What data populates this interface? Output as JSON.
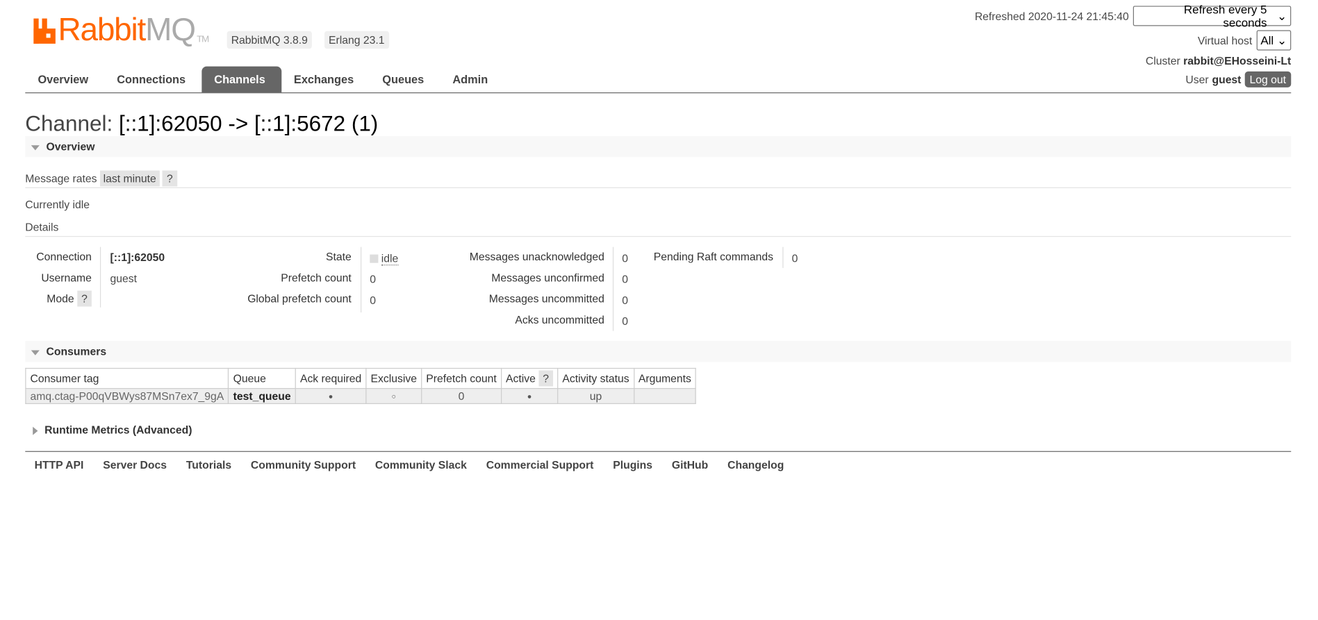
{
  "header": {
    "logo_text_orange": "Rabbit",
    "logo_text_grey": "MQ",
    "logo_tm": "TM",
    "version_badge": "RabbitMQ 3.8.9",
    "erlang_badge": "Erlang 23.1",
    "refreshed_label": "Refreshed 2020-11-24 21:45:40",
    "refresh_select": "Refresh every 5 seconds",
    "vhost_label": "Virtual host",
    "vhost_select": "All",
    "cluster_label": "Cluster",
    "cluster_name": "rabbit@EHosseini-Lt",
    "user_label": "User",
    "user_name": "guest",
    "logout": "Log out",
    "accent": "#ff6600"
  },
  "nav": [
    {
      "label": "Overview"
    },
    {
      "label": "Connections"
    },
    {
      "label": "Channels",
      "selected": true
    },
    {
      "label": "Exchanges"
    },
    {
      "label": "Queues"
    },
    {
      "label": "Admin"
    }
  ],
  "page": {
    "title_label": "Channel:",
    "title_value": "[::1]:62050 -> [::1]:5672 (1)"
  },
  "overview": {
    "heading": "Overview",
    "message_rates_label": "Message rates",
    "message_rates_value": "last minute",
    "help": "?",
    "idle_text": "Currently idle",
    "details_label": "Details",
    "connection_label": "Connection",
    "connection_value": "[::1]:62050",
    "username_label": "Username",
    "username_value": "guest",
    "mode_label": "Mode",
    "state_label": "State",
    "state_value": "idle",
    "prefetch_label": "Prefetch count",
    "prefetch_value": "0",
    "global_prefetch_label": "Global prefetch count",
    "global_prefetch_value": "0",
    "unacked_label": "Messages unacknowledged",
    "unacked_value": "0",
    "unconfirmed_label": "Messages unconfirmed",
    "unconfirmed_value": "0",
    "uncommitted_label": "Messages uncommitted",
    "uncommitted_value": "0",
    "acks_uncommitted_label": "Acks uncommitted",
    "acks_uncommitted_value": "0",
    "raft_label": "Pending Raft commands",
    "raft_value": "0"
  },
  "consumers": {
    "heading": "Consumers",
    "columns": [
      "Consumer tag",
      "Queue",
      "Ack required",
      "Exclusive",
      "Prefetch count",
      "Active",
      "Activity status",
      "Arguments"
    ],
    "rows": [
      {
        "tag": "amq.ctag-P00qVBWys87MSn7ex7_9gA",
        "queue": "test_queue",
        "ack_required": "●",
        "exclusive": "○",
        "prefetch": "0",
        "active": "●",
        "status": "up",
        "arguments": ""
      }
    ]
  },
  "runtime": {
    "heading": "Runtime Metrics (Advanced)"
  },
  "footer": [
    "HTTP API",
    "Server Docs",
    "Tutorials",
    "Community Support",
    "Community Slack",
    "Commercial Support",
    "Plugins",
    "GitHub",
    "Changelog"
  ]
}
